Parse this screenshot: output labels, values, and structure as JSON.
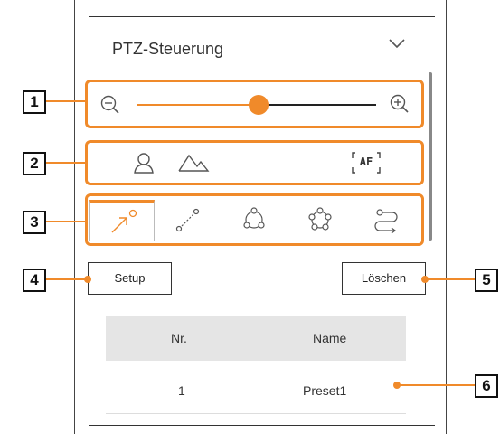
{
  "panel": {
    "title": "PTZ-Steuerung",
    "expand_icon": "chevron-down-icon"
  },
  "zoom": {
    "out_icon": "zoom-out-icon",
    "in_icon": "zoom-in-icon",
    "level": 0.45
  },
  "focus_row": {
    "icons": [
      "person-icon",
      "landscape-icon"
    ],
    "af_label": "AF"
  },
  "tabs": [
    {
      "icon": "arrow-preset-icon",
      "active": true
    },
    {
      "icon": "swing-icon",
      "active": false
    },
    {
      "icon": "group-icon",
      "active": false
    },
    {
      "icon": "tour-icon",
      "active": false
    },
    {
      "icon": "trace-icon",
      "active": false
    }
  ],
  "buttons": {
    "setup": "Setup",
    "delete": "Löschen"
  },
  "table": {
    "headers": [
      "Nr.",
      "Name"
    ],
    "rows": [
      {
        "nr": "1",
        "name": "Preset1"
      }
    ]
  },
  "callouts": [
    "1",
    "2",
    "3",
    "4",
    "5",
    "6"
  ],
  "colors": {
    "accent": "#f08a2a"
  }
}
